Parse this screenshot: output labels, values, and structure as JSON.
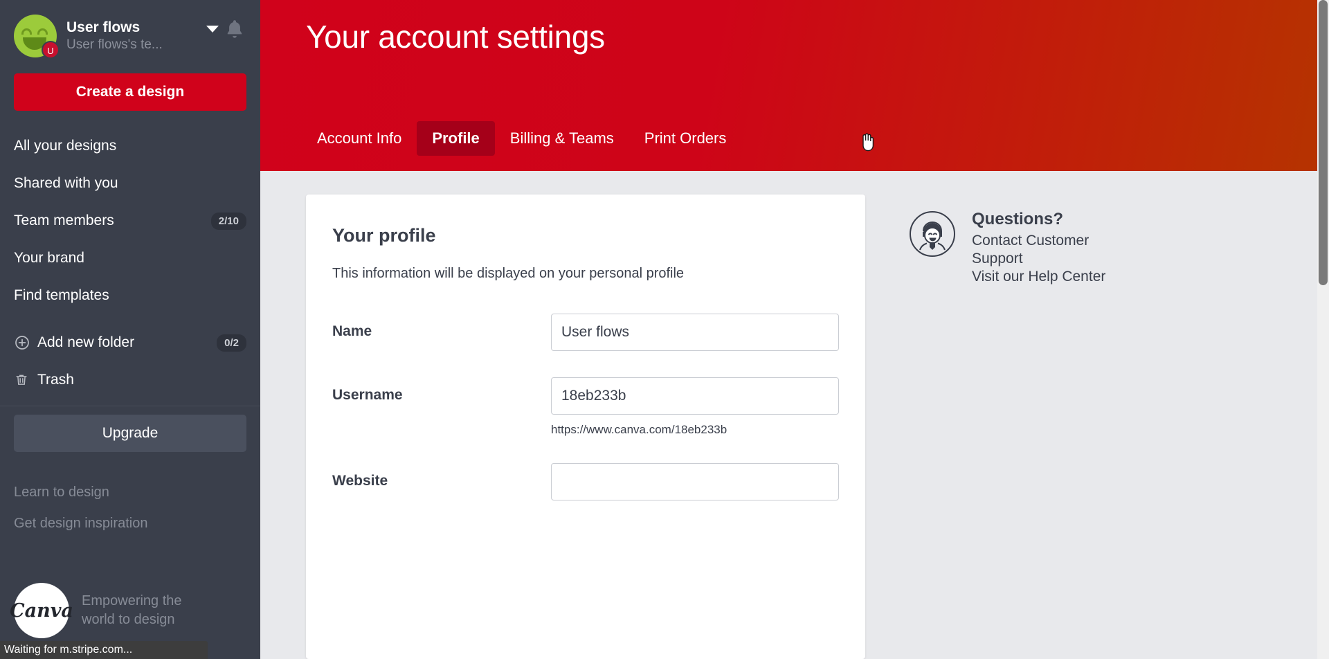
{
  "sidebar": {
    "account": {
      "name": "User flows",
      "subtitle": "User flows's te...",
      "avatar_badge": "U",
      "caret_icon": "chevron-down-icon",
      "bell_icon": "bell-icon"
    },
    "create_button": "Create a design",
    "nav_primary": [
      {
        "label": "All your designs",
        "badge": ""
      },
      {
        "label": "Shared with you",
        "badge": ""
      },
      {
        "label": "Team members",
        "badge": "2/10"
      },
      {
        "label": "Your brand",
        "badge": ""
      },
      {
        "label": "Find templates",
        "badge": ""
      }
    ],
    "nav_secondary": [
      {
        "label": "Add new folder",
        "badge": "0/2",
        "icon": "plus-circle-icon"
      },
      {
        "label": "Trash",
        "badge": "",
        "icon": "trash-icon"
      }
    ],
    "upgrade_button": "Upgrade",
    "sub_links": [
      "Learn to design",
      "Get design inspiration"
    ],
    "brand": {
      "logo_text": "Canva",
      "tagline": "Empowering the world to design"
    }
  },
  "hero": {
    "title": "Your account settings",
    "tabs": [
      {
        "label": "Account Info",
        "active": false
      },
      {
        "label": "Profile",
        "active": true
      },
      {
        "label": "Billing & Teams",
        "active": false
      },
      {
        "label": "Print Orders",
        "active": false
      }
    ]
  },
  "profile_card": {
    "title": "Your profile",
    "description": "This information will be displayed on your personal profile",
    "fields": [
      {
        "label": "Name",
        "value": "User flows",
        "placeholder": "",
        "hint": ""
      },
      {
        "label": "Username",
        "value": "18eb233b",
        "placeholder": "",
        "hint": "https://www.canva.com/18eb233b"
      },
      {
        "label": "Website",
        "value": "",
        "placeholder": "",
        "hint": ""
      }
    ]
  },
  "helper": {
    "icon": "support-agent-icon",
    "title": "Questions?",
    "links": [
      "Contact Customer Support",
      "Visit our Help Center"
    ]
  },
  "statusbar": {
    "text": "Waiting for m.stripe.com..."
  },
  "colors": {
    "sidebar_bg": "#3a3f4b",
    "brand_red": "#d0021b",
    "tab_active": "#a50019",
    "page_bg": "#e8e9ec"
  }
}
